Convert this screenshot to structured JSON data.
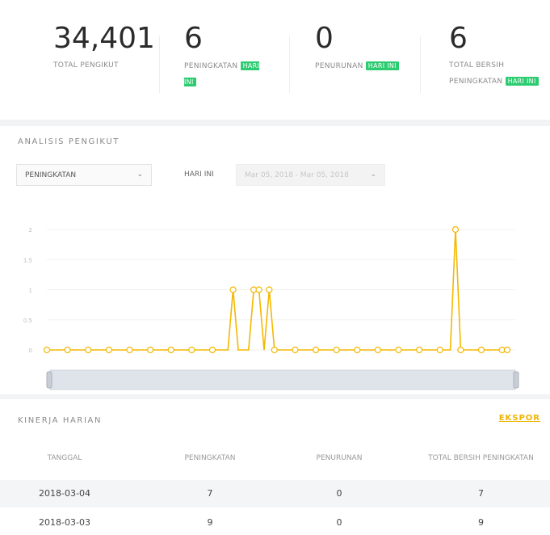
{
  "stats": [
    {
      "value": "34,401",
      "label": "TOTAL PENGIKUT",
      "badge": ""
    },
    {
      "value": "6",
      "label": "PENINGKATAN",
      "badge": "HARI INI"
    },
    {
      "value": "0",
      "label": "PENURUNAN",
      "badge": "HARI INI"
    },
    {
      "value": "6",
      "label": "TOTAL BERSIH PENINGKATAN",
      "badge": "HARI INI"
    }
  ],
  "analysis": {
    "title": "ANALISIS PENGIKUT",
    "metric_select": "PENINGKATAN",
    "period_label": "HARI INI",
    "date_range": "Mar 05, 2018 - Mar 05, 2018"
  },
  "chart_data": {
    "type": "line",
    "color": "#f5b800",
    "yticks": [
      "2",
      "1.5",
      "1",
      "0.5",
      "0"
    ],
    "ylim": [
      0,
      2
    ],
    "values": [
      0,
      0,
      0,
      0,
      0,
      0,
      0,
      0,
      0,
      0,
      0,
      0,
      0,
      0,
      0,
      0,
      0,
      0,
      0,
      0,
      0,
      0,
      0,
      0,
      0,
      0,
      0,
      0,
      0,
      0,
      0,
      0,
      0,
      0,
      0,
      0,
      1,
      0,
      0,
      0,
      1,
      1,
      0,
      1,
      0,
      0,
      0,
      0,
      0,
      0,
      0,
      0,
      0,
      0,
      0,
      0,
      0,
      0,
      0,
      0,
      0,
      0,
      0,
      0,
      0,
      0,
      0,
      0,
      0,
      0,
      0,
      0,
      0,
      0,
      0,
      0,
      0,
      0,
      0,
      2,
      0,
      0,
      0,
      0,
      0,
      0,
      0,
      0,
      0,
      0
    ]
  },
  "daily": {
    "title": "KINERJA HARIAN",
    "export_label": "EKSPOR",
    "headers": [
      "TANGGAL",
      "PENINGKATAN",
      "PENURUNAN",
      "TOTAL BERSIH PENINGKATAN"
    ],
    "rows": [
      [
        "2018-03-04",
        "7",
        "0",
        "7"
      ],
      [
        "2018-03-03",
        "9",
        "0",
        "9"
      ]
    ]
  }
}
